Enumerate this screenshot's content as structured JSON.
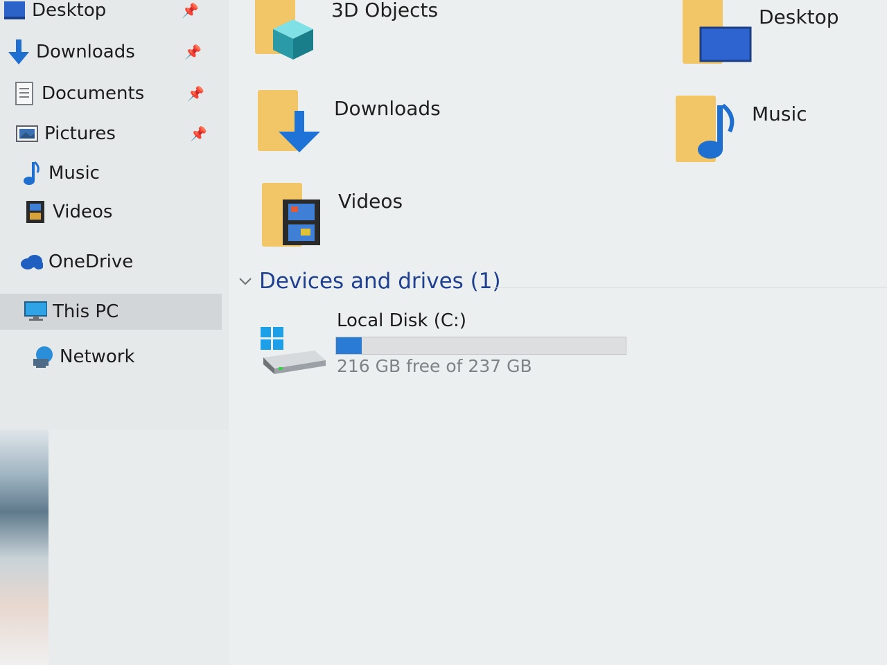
{
  "sidebar": {
    "items": [
      {
        "label": "Desktop",
        "icon": "desktop-icon",
        "pinned": true
      },
      {
        "label": "Downloads",
        "icon": "download-arrow-icon",
        "pinned": true
      },
      {
        "label": "Documents",
        "icon": "document-icon",
        "pinned": true
      },
      {
        "label": "Pictures",
        "icon": "pictures-icon",
        "pinned": true
      },
      {
        "label": "Music",
        "icon": "music-note-icon",
        "pinned": false
      },
      {
        "label": "Videos",
        "icon": "film-icon",
        "pinned": false
      },
      {
        "label": "OneDrive",
        "icon": "cloud-icon",
        "pinned": false
      },
      {
        "label": "This PC",
        "icon": "monitor-icon",
        "pinned": false,
        "selected": true
      },
      {
        "label": "Network",
        "icon": "network-icon",
        "pinned": false
      }
    ]
  },
  "folders": [
    {
      "label": "3D Objects",
      "icon": "cube-icon"
    },
    {
      "label": "Desktop",
      "icon": "desktop-icon"
    },
    {
      "label": "Downloads",
      "icon": "download-arrow-icon"
    },
    {
      "label": "Music",
      "icon": "music-note-icon"
    },
    {
      "label": "Videos",
      "icon": "film-icon"
    }
  ],
  "devices": {
    "title": "Devices and drives (1)",
    "drives": [
      {
        "label": "Local Disk (C:)",
        "free_text": "216 GB free of 237 GB",
        "used_fraction": 0.089
      }
    ]
  },
  "colors": {
    "accent": "#2a7bd3",
    "section_title": "#1f3f8f",
    "folder": "#f2c566",
    "selected_bg": "#d3d6d8"
  }
}
